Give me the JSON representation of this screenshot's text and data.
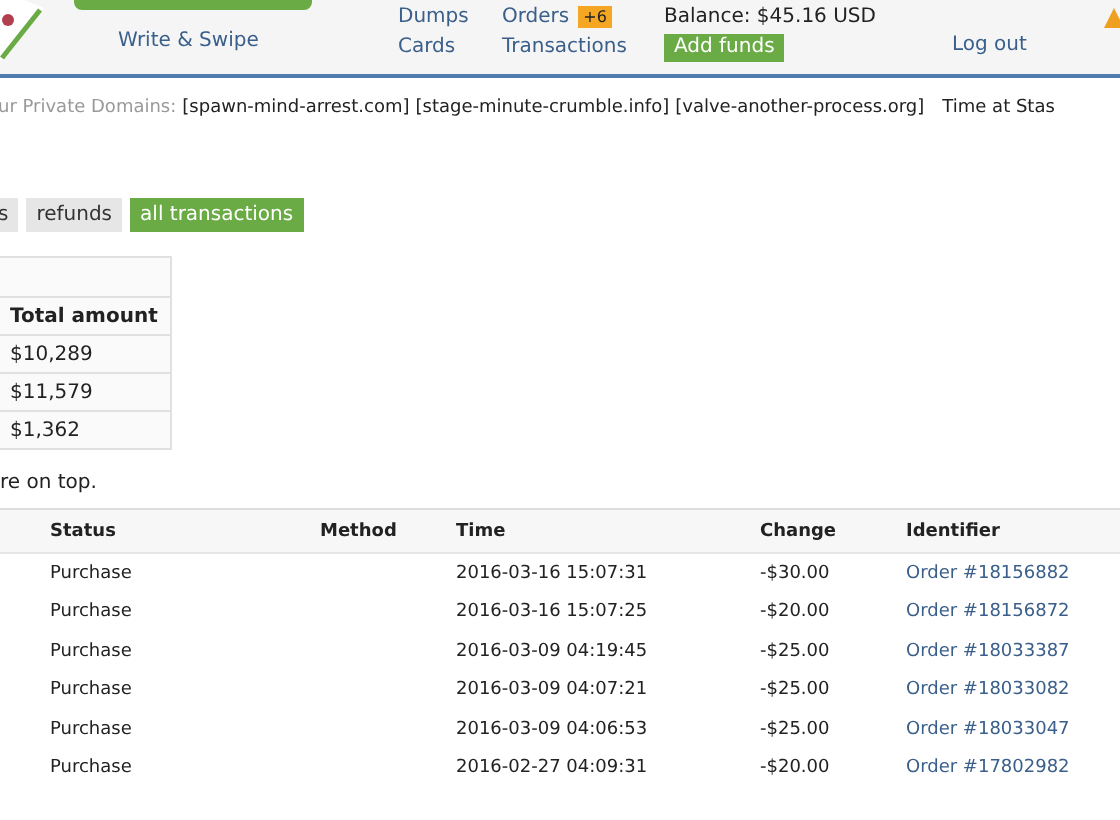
{
  "header": {
    "brand": "Write & Swipe",
    "nav": [
      {
        "top": "Dumps",
        "bottom": "Cards"
      },
      {
        "top": "Orders",
        "badge": "+6",
        "bottom": "Transactions"
      }
    ],
    "balance": "Balance: $45.16 USD",
    "add_funds": "Add funds",
    "logout": "Log out"
  },
  "domains": {
    "label": "ur Private Domains:",
    "items": [
      "[spawn-mind-arrest.com]",
      "[stage-minute-crumble.info]",
      "[valve-another-process.org]"
    ],
    "time_label": "Time at Stas"
  },
  "filters": [
    {
      "label": "s",
      "selected": false
    },
    {
      "label": "refunds",
      "selected": false
    },
    {
      "label": "all transactions",
      "selected": true
    }
  ],
  "summary": {
    "heading": "Total amount",
    "values": [
      "$10,289",
      "$11,579",
      "$1,362"
    ]
  },
  "note": "re on top.",
  "transactions": {
    "columns": [
      "Status",
      "Method",
      "Time",
      "Change",
      "Identifier"
    ],
    "rows": [
      {
        "status": "Purchase",
        "time": "2016-03-16 15:07:31",
        "change": "-$30.00",
        "identifier": "Order #18156882"
      },
      {
        "status": "Purchase",
        "time": "2016-03-16 15:07:25",
        "change": "-$20.00",
        "identifier": "Order #18156872"
      },
      {
        "status": "Purchase",
        "time": "2016-03-09 04:19:45",
        "change": "-$25.00",
        "identifier": "Order #18033387"
      },
      {
        "status": "Purchase",
        "time": "2016-03-09 04:07:21",
        "change": "-$25.00",
        "identifier": "Order #18033082"
      },
      {
        "status": "Purchase",
        "time": "2016-03-09 04:06:53",
        "change": "-$25.00",
        "identifier": "Order #18033047"
      },
      {
        "status": "Purchase",
        "time": "2016-02-27 04:09:31",
        "change": "-$20.00",
        "identifier": "Order #17802982"
      }
    ]
  }
}
